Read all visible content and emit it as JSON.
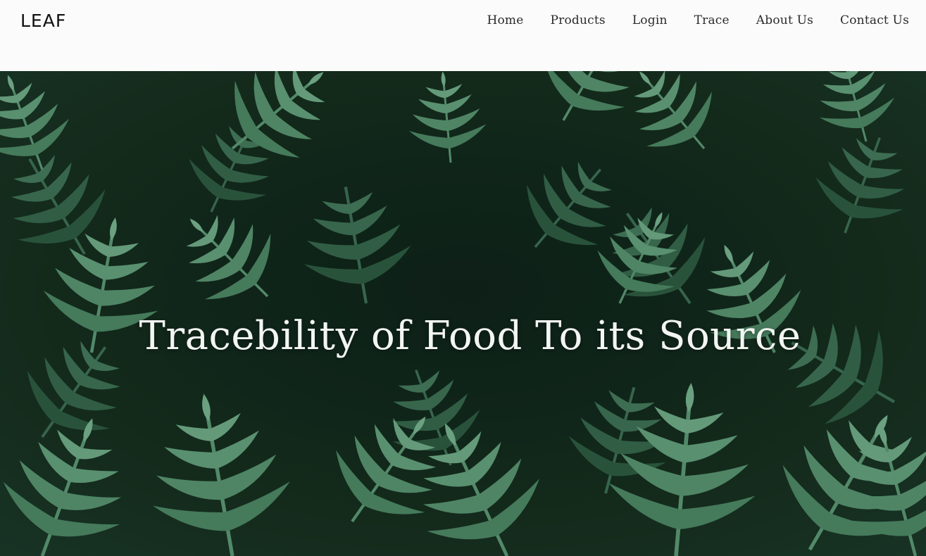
{
  "brand": {
    "logo": "LEAF"
  },
  "nav": {
    "items": [
      {
        "label": "Home"
      },
      {
        "label": "Products"
      },
      {
        "label": "Login"
      },
      {
        "label": "Trace"
      },
      {
        "label": "About Us"
      },
      {
        "label": "Contact Us"
      }
    ]
  },
  "hero": {
    "title": "Tracebility of Food To its Source",
    "background_image": "fern-foliage-photo"
  },
  "colors": {
    "header_bg": "#fbfbfb",
    "text_dark": "#2a2a2a",
    "hero_bg": "#173226",
    "hero_text": "#f2f5f2"
  }
}
